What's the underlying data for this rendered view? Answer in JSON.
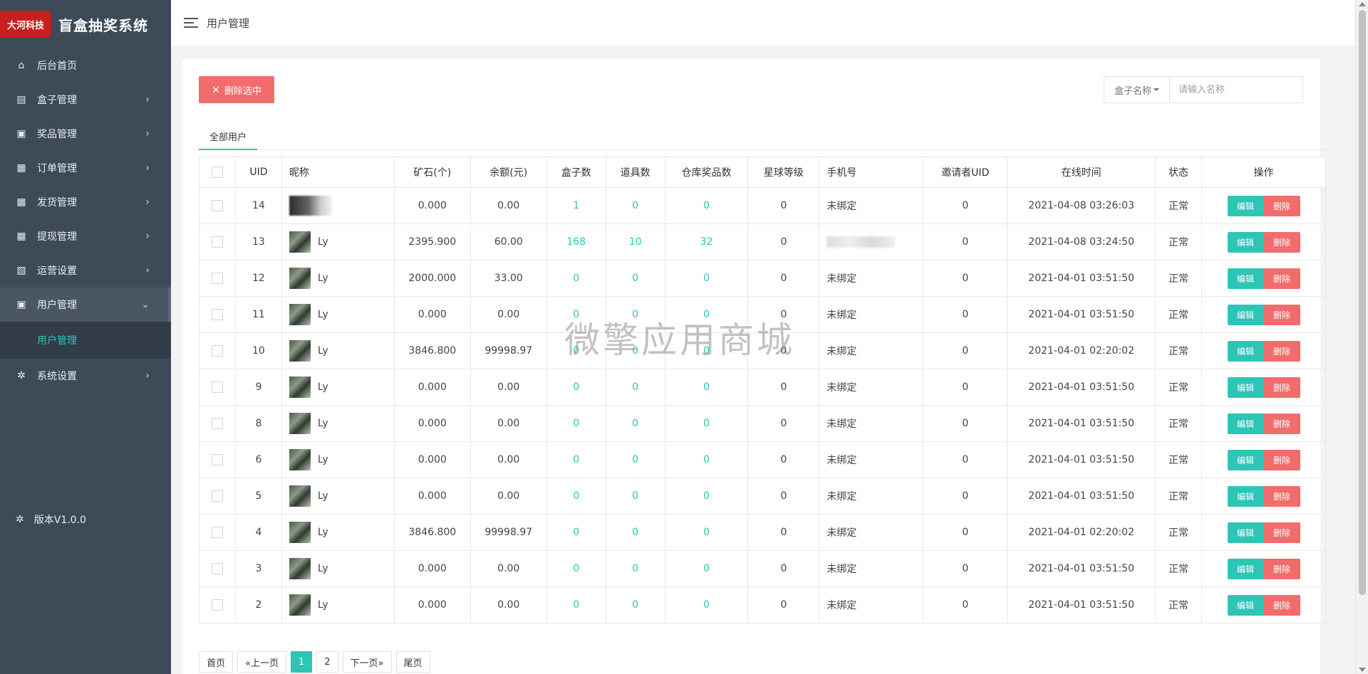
{
  "brand": {
    "logo": "大河科技",
    "title": "盲盒抽奖系统"
  },
  "sidebar": {
    "items": [
      {
        "label": "后台首页",
        "icon": "home-icon",
        "glyph": "⌂",
        "has_chevron": false
      },
      {
        "label": "盒子管理",
        "icon": "box-icon",
        "glyph": "▤",
        "has_chevron": true
      },
      {
        "label": "奖品管理",
        "icon": "gift-icon",
        "glyph": "▣",
        "has_chevron": true
      },
      {
        "label": "订单管理",
        "icon": "clipboard-icon",
        "glyph": "▦",
        "has_chevron": true
      },
      {
        "label": "发货管理",
        "icon": "clipboard-icon",
        "glyph": "▦",
        "has_chevron": true
      },
      {
        "label": "提现管理",
        "icon": "clipboard-icon",
        "glyph": "▦",
        "has_chevron": true
      },
      {
        "label": "运营设置",
        "icon": "chart-icon",
        "glyph": "▨",
        "has_chevron": true
      },
      {
        "label": "用户管理",
        "icon": "user-card-icon",
        "glyph": "▣",
        "has_chevron": true,
        "active": true
      }
    ],
    "sub_item": "用户管理",
    "system": {
      "label": "系统设置",
      "icon": "gear-icon",
      "glyph": "✲"
    },
    "version": "版本V1.0.0",
    "chevron_right": "›",
    "chevron_down": "⌄"
  },
  "topbar": {
    "title": "用户管理"
  },
  "toolbar": {
    "delete_selected": "删除选中",
    "delete_icon": "✕"
  },
  "search": {
    "select_label": "盒子名称",
    "placeholder": "请输入名称"
  },
  "tabs": [
    "全部用户"
  ],
  "table": {
    "headers": [
      "UID",
      "昵称",
      "矿石(个)",
      "余额(元)",
      "盒子数",
      "道具数",
      "仓库奖品数",
      "星球等级",
      "手机号",
      "邀请者UID",
      "在线时间",
      "状态",
      "操作"
    ],
    "rows": [
      {
        "uid": "14",
        "nick": "",
        "ore": "0.000",
        "balance": "0.00",
        "boxes": "1",
        "props": "0",
        "warehouse": "0",
        "level": "0",
        "phone": "未绑定",
        "inviter": "0",
        "online": "2021-04-08 03:26:03",
        "status": "正常"
      },
      {
        "uid": "13",
        "nick": "Ly",
        "ore": "2395.900",
        "balance": "60.00",
        "boxes": "168",
        "props": "10",
        "warehouse": "32",
        "level": "0",
        "phone": "",
        "inviter": "0",
        "online": "2021-04-08 03:24:50",
        "status": "正常"
      },
      {
        "uid": "12",
        "nick": "Ly",
        "ore": "2000.000",
        "balance": "33.00",
        "boxes": "0",
        "props": "0",
        "warehouse": "0",
        "level": "0",
        "phone": "未绑定",
        "inviter": "0",
        "online": "2021-04-01 03:51:50",
        "status": "正常"
      },
      {
        "uid": "11",
        "nick": "Ly",
        "ore": "0.000",
        "balance": "0.00",
        "boxes": "0",
        "props": "0",
        "warehouse": "0",
        "level": "0",
        "phone": "未绑定",
        "inviter": "0",
        "online": "2021-04-01 03:51:50",
        "status": "正常"
      },
      {
        "uid": "10",
        "nick": "Ly",
        "ore": "3846.800",
        "balance": "99998.97",
        "boxes": "0",
        "props": "0",
        "warehouse": "0",
        "level": "0",
        "phone": "未绑定",
        "inviter": "0",
        "online": "2021-04-01 02:20:02",
        "status": "正常"
      },
      {
        "uid": "9",
        "nick": "Ly",
        "ore": "0.000",
        "balance": "0.00",
        "boxes": "0",
        "props": "0",
        "warehouse": "0",
        "level": "0",
        "phone": "未绑定",
        "inviter": "0",
        "online": "2021-04-01 03:51:50",
        "status": "正常"
      },
      {
        "uid": "8",
        "nick": "Ly",
        "ore": "0.000",
        "balance": "0.00",
        "boxes": "0",
        "props": "0",
        "warehouse": "0",
        "level": "0",
        "phone": "未绑定",
        "inviter": "0",
        "online": "2021-04-01 03:51:50",
        "status": "正常"
      },
      {
        "uid": "6",
        "nick": "Ly",
        "ore": "0.000",
        "balance": "0.00",
        "boxes": "0",
        "props": "0",
        "warehouse": "0",
        "level": "0",
        "phone": "未绑定",
        "inviter": "0",
        "online": "2021-04-01 03:51:50",
        "status": "正常"
      },
      {
        "uid": "5",
        "nick": "Ly",
        "ore": "0.000",
        "balance": "0.00",
        "boxes": "0",
        "props": "0",
        "warehouse": "0",
        "level": "0",
        "phone": "未绑定",
        "inviter": "0",
        "online": "2021-04-01 03:51:50",
        "status": "正常"
      },
      {
        "uid": "4",
        "nick": "Ly",
        "ore": "3846.800",
        "balance": "99998.97",
        "boxes": "0",
        "props": "0",
        "warehouse": "0",
        "level": "0",
        "phone": "未绑定",
        "inviter": "0",
        "online": "2021-04-01 02:20:02",
        "status": "正常"
      },
      {
        "uid": "3",
        "nick": "Ly",
        "ore": "0.000",
        "balance": "0.00",
        "boxes": "0",
        "props": "0",
        "warehouse": "0",
        "level": "0",
        "phone": "未绑定",
        "inviter": "0",
        "online": "2021-04-01 03:51:50",
        "status": "正常"
      },
      {
        "uid": "2",
        "nick": "Ly",
        "ore": "0.000",
        "balance": "0.00",
        "boxes": "0",
        "props": "0",
        "warehouse": "0",
        "level": "0",
        "phone": "未绑定",
        "inviter": "0",
        "online": "2021-04-01 03:51:50",
        "status": "正常"
      }
    ],
    "edit_label": "编辑",
    "delete_label": "删除"
  },
  "pagination": {
    "first": "首页",
    "prev": "«上一页",
    "pages": [
      "1",
      "2"
    ],
    "current": "1",
    "next": "下一页»",
    "last": "尾页"
  },
  "watermark": "微擎应用商城",
  "colors": {
    "accent": "#2dc5b5",
    "danger": "#f26c6c",
    "sidebar": "#3d4a58"
  }
}
